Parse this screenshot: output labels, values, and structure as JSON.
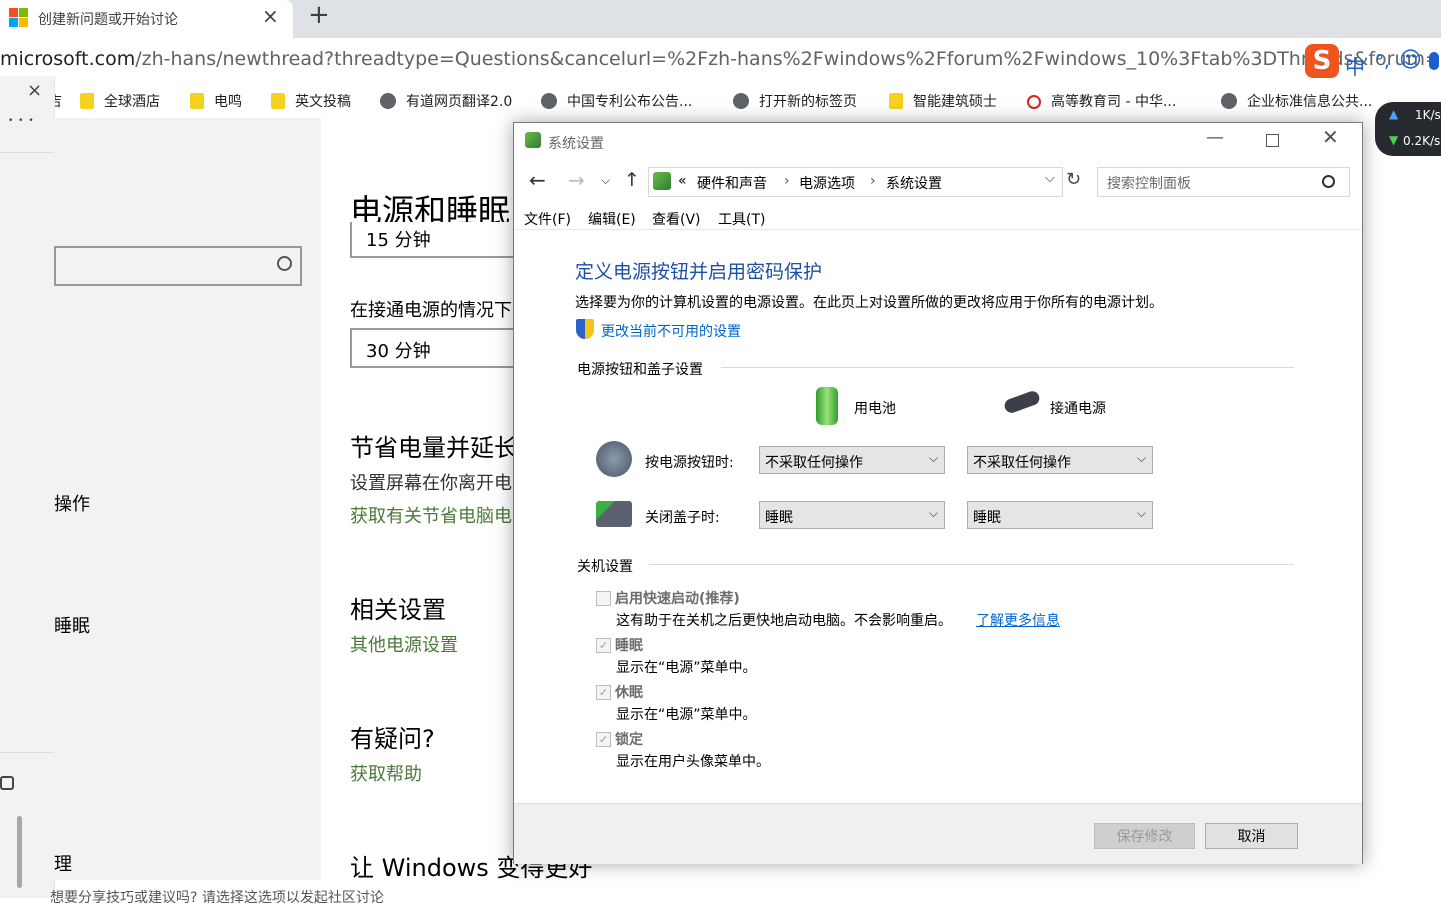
{
  "browser": {
    "tab_title": "创建新问题或开始讨论",
    "tab_close": "×",
    "new_tab": "+",
    "url_host": "microsoft.com",
    "url_rest": "/zh-hans/newthread?threadtype=Questions&cancelurl=%2Fzh-hans%2Fwindows%2Fforum%2Fwindows_10%3Ftab%3DThreads&forum=wind",
    "bookmarks": [
      {
        "label": "吉",
        "icon": "folder-icon"
      },
      {
        "label": "全球酒店",
        "icon": "folder-icon"
      },
      {
        "label": "电鸣",
        "icon": "folder-icon"
      },
      {
        "label": "英文投稿",
        "icon": "folder-icon"
      },
      {
        "label": "有道网页翻译2.0",
        "icon": "globe-icon"
      },
      {
        "label": "中国专利公布公告...",
        "icon": "globe-icon"
      },
      {
        "label": "打开新的标签页",
        "icon": "globe-icon"
      },
      {
        "label": "智能建筑硕士",
        "icon": "folder-icon"
      },
      {
        "label": "高等教育司 - 中华...",
        "icon": "red-logo-icon"
      },
      {
        "label": "企业标准信息公共...",
        "icon": "globe-icon"
      }
    ]
  },
  "ime": {
    "logo": "S",
    "lang": "中",
    "punct": "°,",
    "emoji": "☺",
    "mic": "🎤"
  },
  "netspeed": {
    "up": "1K/s",
    "down": "0.2K/s"
  },
  "left_panel": {
    "close": "×",
    "more": "• • •"
  },
  "settings": {
    "side_items": [
      "操作",
      "",
      "睡眠",
      "",
      "理"
    ],
    "title": "电源和睡眠",
    "partial_dropdown": "15 分钟",
    "plugged_label": "在接通电源的情况下",
    "plugged_value": "30 分钟",
    "save_title": "节省电量并延长",
    "save_text": "设置屏幕在你离开电",
    "save_link": "获取有关节省电脑电",
    "related_title": "相关设置",
    "related_link": "其他电源设置",
    "question_title": "有疑问?",
    "question_link": "获取帮助",
    "improve_title": "让 Windows 变得更好",
    "bottom_text": "想要分享技巧或建议吗? 请选择这选项以发起社区讨论"
  },
  "control_panel": {
    "window_title": "系统设置",
    "breadcrumb": [
      "硬件和声音",
      "电源选项",
      "系统设置"
    ],
    "breadcrumb_prefix": "«",
    "search_placeholder": "搜索控制面板",
    "menu": [
      "文件(F)",
      "编辑(E)",
      "查看(V)",
      "工具(T)"
    ],
    "heading": "定义电源按钮并启用密码保护",
    "description": "选择要为你的计算机设置的电源设置。在此页上对设置所做的更改将应用于你所有的电源计划。",
    "change_link": "更改当前不可用的设置",
    "section_buttons": "电源按钮和盖子设置",
    "col_battery": "用电池",
    "col_plugged": "接通电源",
    "power_button_label": "按电源按钮时:",
    "power_button_battery": "不采取任何操作",
    "power_button_plugged": "不采取任何操作",
    "lid_label": "关闭盖子时:",
    "lid_battery": "睡眠",
    "lid_plugged": "睡眠",
    "section_shutdown": "关机设置",
    "fast_startup": {
      "label": "启用快速启动(推荐)",
      "checked": false,
      "desc": "这有助于在关机之后更快地启动电脑。不会影响重启。",
      "link": "了解更多信息"
    },
    "sleep": {
      "label": "睡眠",
      "checked": true,
      "desc": "显示在“电源”菜单中。"
    },
    "hibernate": {
      "label": "休眠",
      "checked": true,
      "desc": "显示在“电源”菜单中。"
    },
    "lock": {
      "label": "锁定",
      "checked": true,
      "desc": "显示在用户头像菜单中。"
    },
    "save_button": "保存修改",
    "cancel_button": "取消",
    "check_mark": "✓",
    "dropdown_arrow": "⌵"
  }
}
